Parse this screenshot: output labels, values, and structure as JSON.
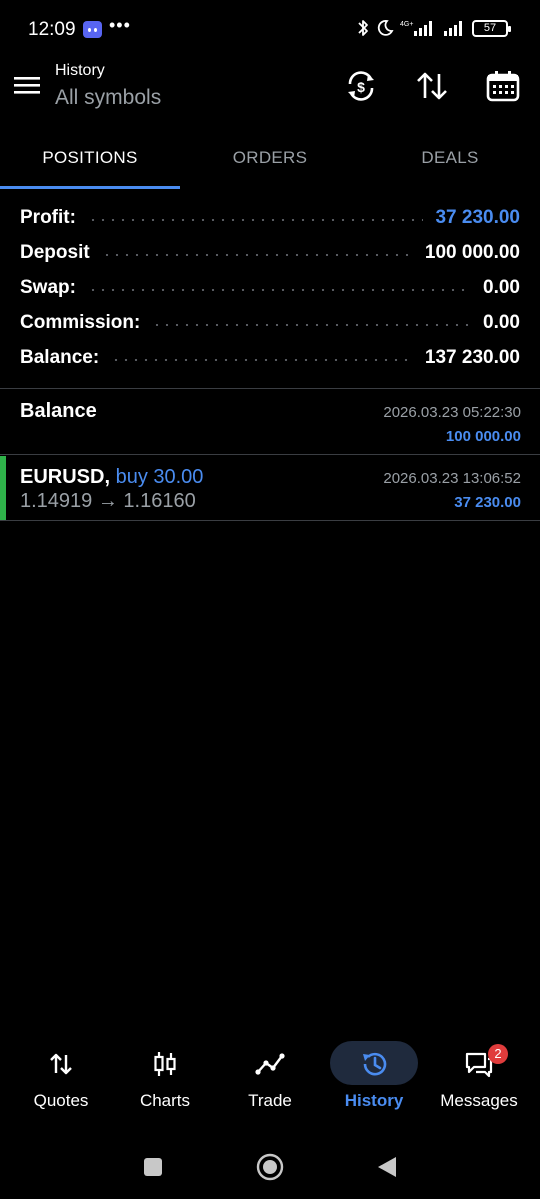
{
  "status_bar": {
    "time": "12:09",
    "more": "•••",
    "battery": "57",
    "network": "4G+",
    "icons": [
      "discord-icon",
      "bluetooth-icon",
      "moon-icon",
      "signal-icon",
      "battery-icon"
    ]
  },
  "header": {
    "title": "History",
    "subtitle": "All symbols",
    "icons": [
      "menu-icon",
      "currency-sync-icon",
      "sort-icon",
      "calendar-icon"
    ]
  },
  "tabs": [
    {
      "label": "POSITIONS",
      "active": true
    },
    {
      "label": "ORDERS",
      "active": false
    },
    {
      "label": "DEALS",
      "active": false
    }
  ],
  "summary": [
    {
      "label": "Profit:",
      "value": "37 230.00",
      "highlight": true
    },
    {
      "label": "Deposit",
      "value": "100 000.00",
      "highlight": false
    },
    {
      "label": "Swap:",
      "value": "0.00",
      "highlight": false
    },
    {
      "label": "Commission:",
      "value": "0.00",
      "highlight": false
    },
    {
      "label": "Balance:",
      "value": "137 230.00",
      "highlight": false
    }
  ],
  "history": {
    "balance_entry": {
      "name": "Balance",
      "date": "2026.03.23 05:22:30",
      "amount": "100 000.00"
    },
    "position_entry": {
      "symbol": "EURUSD,",
      "side": "buy 30.00",
      "prices": "1.14919 → 1.16160",
      "date": "2026.03.23 13:06:52",
      "amount": "37 230.00"
    }
  },
  "bottom_nav": [
    {
      "label": "Quotes",
      "icon": "quotes-arrows-icon",
      "active": false
    },
    {
      "label": "Charts",
      "icon": "candlestick-icon",
      "active": false
    },
    {
      "label": "Trade",
      "icon": "trend-line-icon",
      "active": false
    },
    {
      "label": "History",
      "icon": "history-clock-icon",
      "active": true
    },
    {
      "label": "Messages",
      "icon": "messages-icon",
      "active": false,
      "badge": "2"
    }
  ],
  "colors": {
    "accent": "#4a8cf0",
    "profit_bar": "#2fb24a",
    "badge": "#e03c3c",
    "background": "#000000"
  }
}
